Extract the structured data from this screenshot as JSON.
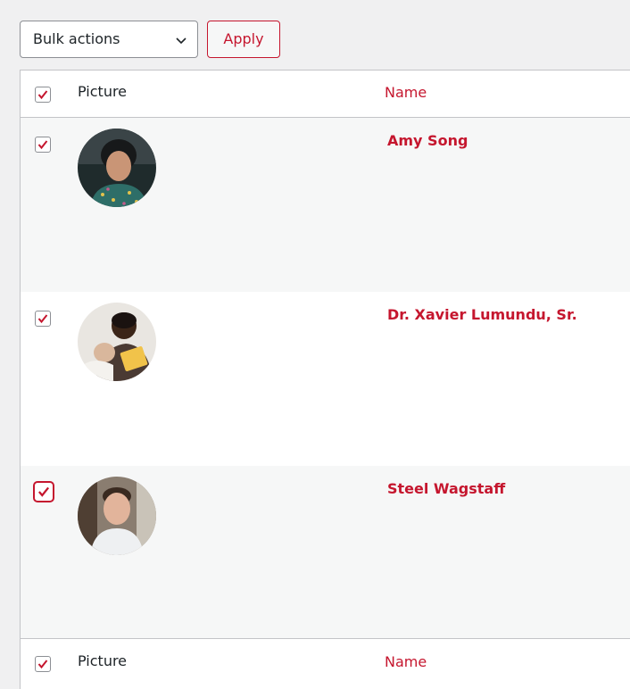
{
  "toolbar": {
    "bulk_actions_selected": "Bulk actions",
    "apply_label": "Apply"
  },
  "table": {
    "header": {
      "picture": "Picture",
      "name": "Name"
    },
    "footer": {
      "picture": "Picture",
      "name": "Name"
    },
    "rows": [
      {
        "name": "Amy Song",
        "checked": true,
        "avatar": "woman-smiling-photo"
      },
      {
        "name": "Dr. Xavier Lumundu, Sr.",
        "checked": true,
        "avatar": "man-reading-with-baby-photo"
      },
      {
        "name": "Steel Wagstaff",
        "checked": true,
        "avatar": "man-portrait-photo"
      }
    ]
  },
  "colors": {
    "accent": "#c5162e",
    "row_alt": "#f6f7f7",
    "border": "#c3c4c7"
  }
}
